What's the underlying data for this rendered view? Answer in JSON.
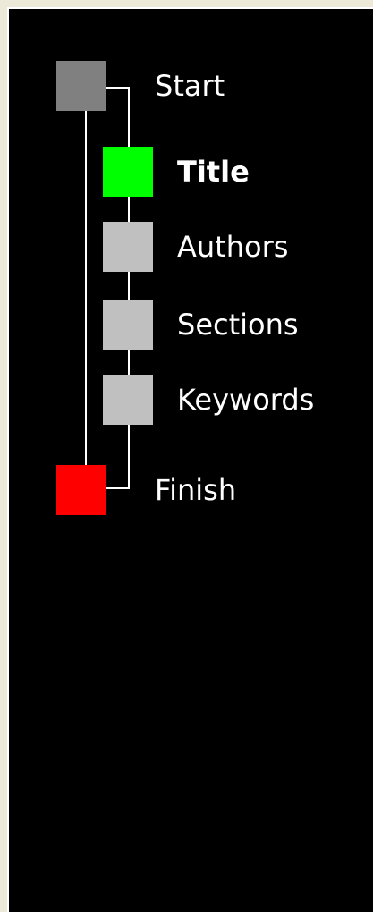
{
  "wizard": {
    "steps": [
      {
        "id": "start",
        "label": "Start",
        "color": "#808080",
        "state": "terminal"
      },
      {
        "id": "title",
        "label": "Title",
        "color": "#00ff00",
        "state": "current"
      },
      {
        "id": "authors",
        "label": "Authors",
        "color": "#c0c0c0",
        "state": "pending"
      },
      {
        "id": "sections",
        "label": "Sections",
        "color": "#c0c0c0",
        "state": "pending"
      },
      {
        "id": "keywords",
        "label": "Keywords",
        "color": "#c0c0c0",
        "state": "pending"
      },
      {
        "id": "finish",
        "label": "Finish",
        "color": "#ff0000",
        "state": "terminal"
      }
    ]
  },
  "colors": {
    "panel_background": "#000000",
    "frame_background": "#ece9d8",
    "connector": "#ffffff",
    "label_text": "#ffffff"
  }
}
